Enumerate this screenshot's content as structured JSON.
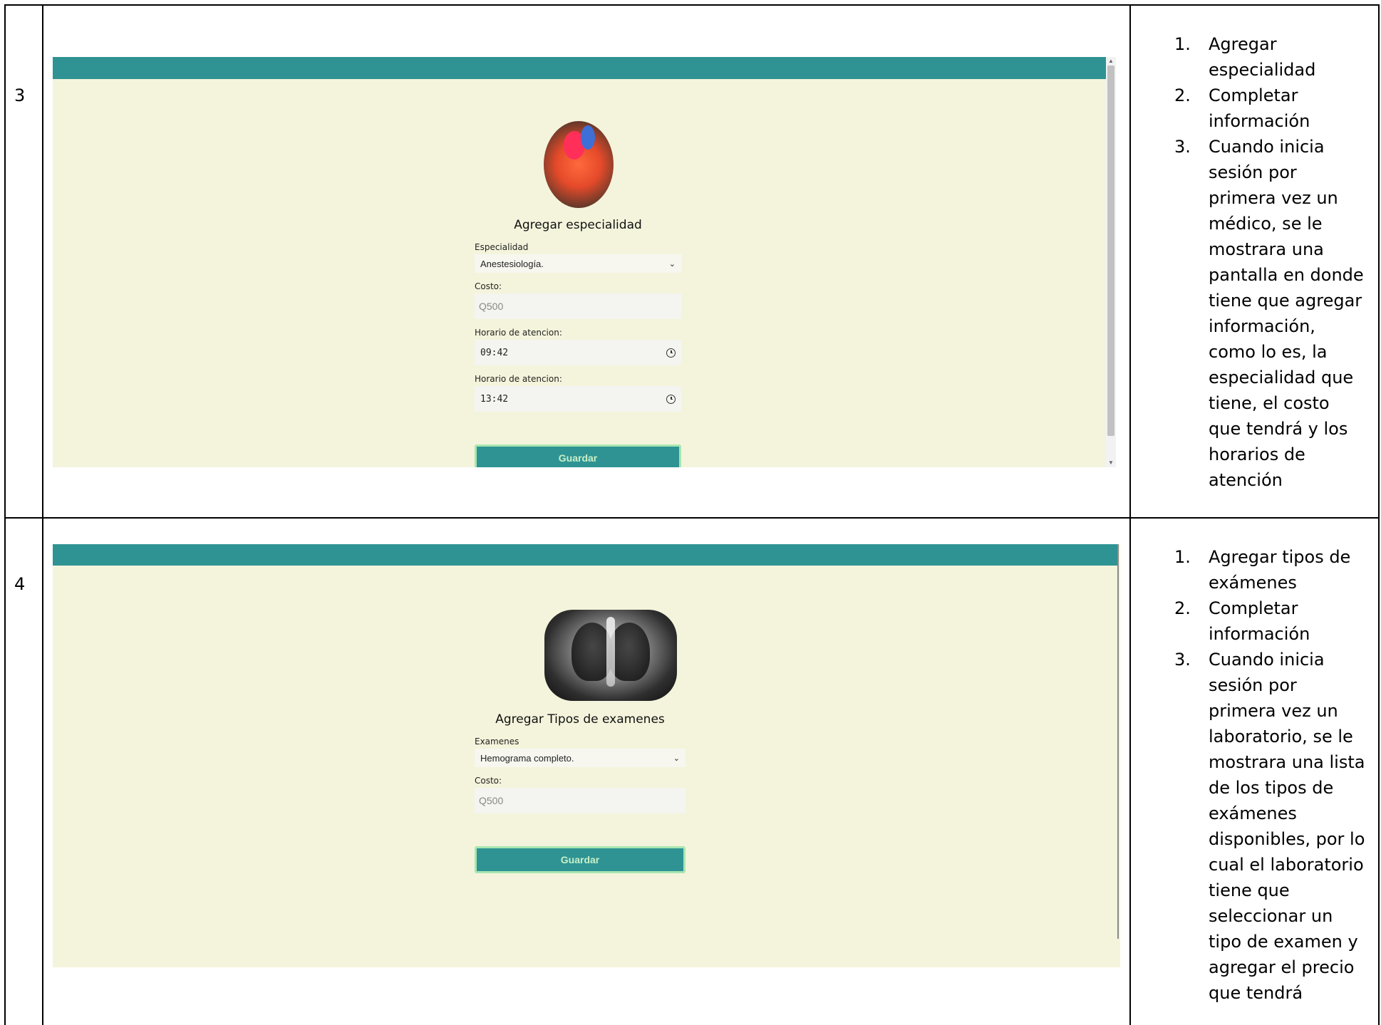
{
  "rows": [
    {
      "number": "3",
      "form": {
        "title": "Agregar especialidad",
        "fields": [
          {
            "label": "Especialidad",
            "type": "select",
            "value": "Anestesiología."
          },
          {
            "label": "Costo:",
            "type": "text",
            "placeholder": "Q500"
          },
          {
            "label": "Horario de atencion:",
            "type": "time",
            "value": "09:42"
          },
          {
            "label": "Horario de atencion:",
            "type": "time",
            "value": "13:42"
          }
        ],
        "button": "Guardar"
      },
      "notes": [
        {
          "num": "1.",
          "text": "Agregar especialidad"
        },
        {
          "num": "2.",
          "text": "Completar información"
        },
        {
          "num": "3.",
          "text": "Cuando inicia sesión por primera vez un médico, se le mostrara una pantalla en donde tiene que agregar información, como lo es, la especialidad que tiene, el costo que tendrá y los horarios de atención"
        }
      ]
    },
    {
      "number": "4",
      "form": {
        "title": "Agregar Tipos de examenes",
        "fields": [
          {
            "label": "Examenes",
            "type": "select",
            "value": "Hemograma completo."
          },
          {
            "label": "Costo:",
            "type": "text",
            "placeholder": "Q500"
          }
        ],
        "button": "Guardar"
      },
      "notes": [
        {
          "num": "1.",
          "text": "Agregar tipos de exámenes"
        },
        {
          "num": "2.",
          "text": "Completar información"
        },
        {
          "num": "3.",
          "text": "Cuando inicia sesión por primera vez un laboratorio, se le mostrara una lista de los tipos de exámenes disponibles, por lo cual el laboratorio tiene que seleccionar un tipo de examen y agregar el precio que tendrá"
        }
      ]
    }
  ],
  "colors": {
    "header_teal": "#2f9393",
    "page_background": "#f4f4dc",
    "button_border": "#a8e6b0"
  }
}
